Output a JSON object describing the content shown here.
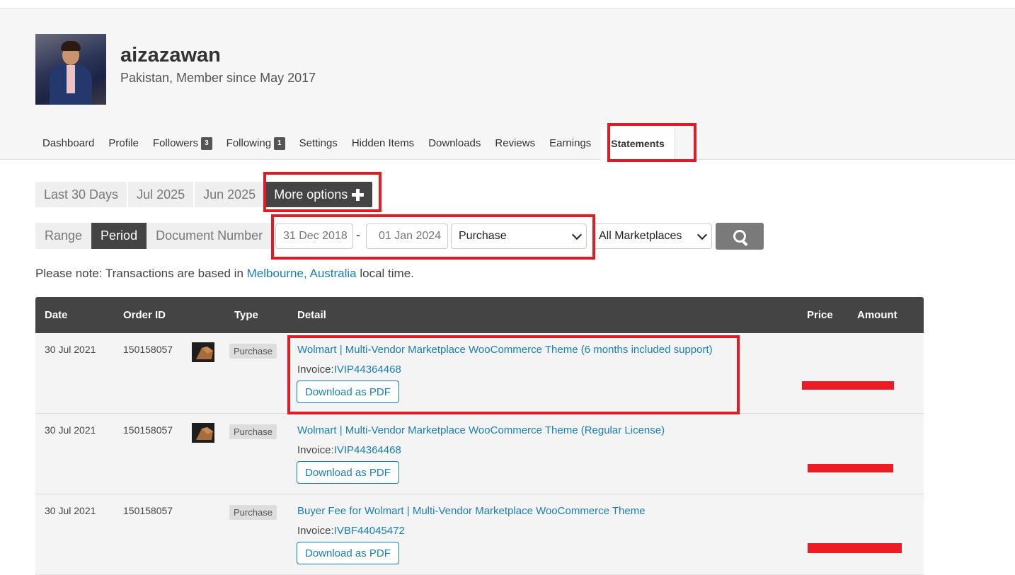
{
  "profile": {
    "username": "aizazawan",
    "member_info": "Pakistan, Member since May 2017"
  },
  "tabs": [
    {
      "label": "Dashboard"
    },
    {
      "label": "Profile"
    },
    {
      "label": "Followers",
      "badge": "3"
    },
    {
      "label": "Following",
      "badge": "1"
    },
    {
      "label": "Settings"
    },
    {
      "label": "Hidden Items"
    },
    {
      "label": "Downloads"
    },
    {
      "label": "Reviews"
    },
    {
      "label": "Earnings"
    },
    {
      "label": "Statements",
      "active": true
    }
  ],
  "period_buttons": {
    "last30": "Last 30 Days",
    "jul": "Jul 2025",
    "jun": "Jun 2025",
    "more": "More options"
  },
  "mode_buttons": {
    "range": "Range",
    "period": "Period",
    "document": "Document Number"
  },
  "filters": {
    "date_from": "31 Dec 2018",
    "date_to": "01 Jan 2024",
    "separator": "-",
    "type_selected": "Purchase",
    "marketplace_selected": "All Marketplaces"
  },
  "note": {
    "prefix": "Please note: Transactions are based in ",
    "link": "Melbourne, Australia",
    "suffix": " local time."
  },
  "table": {
    "headers": {
      "date": "Date",
      "order": "Order ID",
      "type": "Type",
      "detail": "Detail",
      "price": "Price",
      "amount": "Amount"
    },
    "rows": [
      {
        "date": "30 Jul 2021",
        "order_id": "150158057",
        "type": "Purchase",
        "title": "Wolmart | Multi-Vendor Marketplace WooCommerce Theme (6 months included support)",
        "invoice_label": "Invoice:",
        "invoice": "IVIP44364468",
        "button": "Download as PDF"
      },
      {
        "date": "30 Jul 2021",
        "order_id": "150158057",
        "type": "Purchase",
        "title": "Wolmart | Multi-Vendor Marketplace WooCommerce Theme (Regular License)",
        "invoice_label": "Invoice:",
        "invoice": "IVIP44364468",
        "button": "Download as PDF"
      },
      {
        "date": "30 Jul 2021",
        "order_id": "150158057",
        "type": "Purchase",
        "title": "Buyer Fee for Wolmart | Multi-Vendor Marketplace WooCommerce Theme",
        "invoice_label": "Invoice:",
        "invoice": "IVBF44045472",
        "button": "Download as PDF"
      }
    ]
  },
  "colors": {
    "highlight": "#e01b24",
    "link": "#1a7fb5",
    "header_bg": "#444444",
    "redaction": "#ed1c24"
  }
}
